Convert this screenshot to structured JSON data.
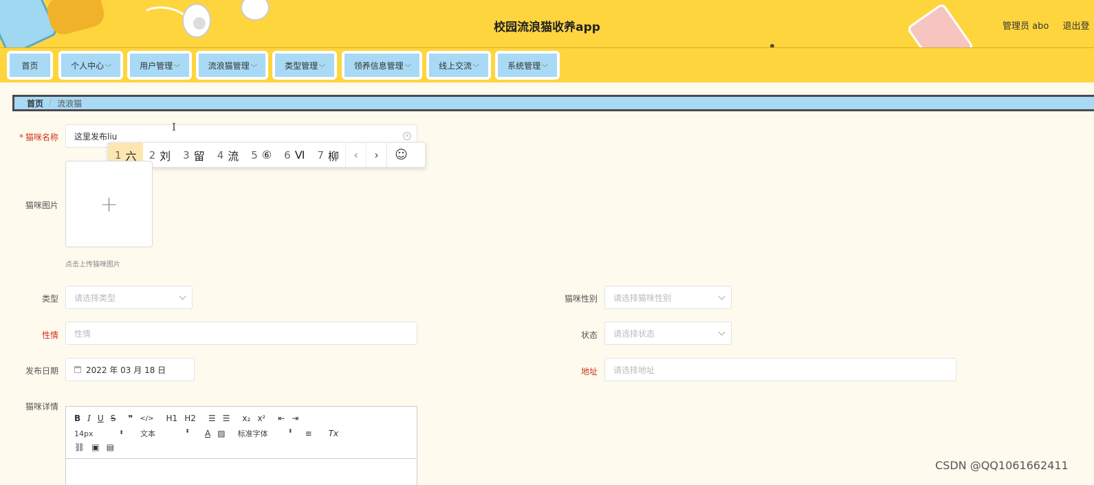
{
  "header": {
    "title": "校园流浪猫收养app",
    "user_label": "管理员 abo",
    "logout_label": "退出登"
  },
  "nav": {
    "items": [
      {
        "label": "首页",
        "dropdown": false
      },
      {
        "label": "个人中心",
        "dropdown": true
      },
      {
        "label": "用户管理",
        "dropdown": true
      },
      {
        "label": "流浪猫管理",
        "dropdown": true
      },
      {
        "label": "类型管理",
        "dropdown": true
      },
      {
        "label": "领养信息管理",
        "dropdown": true
      },
      {
        "label": "线上交流",
        "dropdown": true
      },
      {
        "label": "系统管理",
        "dropdown": true
      }
    ],
    "chevron_icon": "chevron-down-icon"
  },
  "breadcrumb": {
    "home": "首页",
    "separator": "/",
    "current": "流浪猫"
  },
  "form": {
    "cat_name": {
      "label": "猫咪名称",
      "required_mark": "*",
      "value": "这里发布liu"
    },
    "cat_image": {
      "label": "猫咪图片",
      "upload_tip": "点击上传猫咪图片",
      "icon": "plus-icon"
    },
    "type": {
      "label": "类型",
      "placeholder": "请选择类型"
    },
    "gender": {
      "label": "猫咪性别",
      "placeholder": "请选择猫咪性别"
    },
    "temperament": {
      "label": "性情",
      "placeholder": "性情"
    },
    "status": {
      "label": "状态",
      "placeholder": "请选择状态"
    },
    "publish_date": {
      "label": "发布日期",
      "value": "2022 年 03 月 18 日"
    },
    "address": {
      "label": "地址",
      "placeholder": "请选择地址"
    },
    "details": {
      "label": "猫咪详情"
    }
  },
  "ime": {
    "candidates": [
      {
        "n": "1",
        "text": "六"
      },
      {
        "n": "2",
        "text": "刘"
      },
      {
        "n": "3",
        "text": "留"
      },
      {
        "n": "4",
        "text": "流"
      },
      {
        "n": "5",
        "text": "⑥"
      },
      {
        "n": "6",
        "text": "Ⅵ"
      },
      {
        "n": "7",
        "text": "柳"
      }
    ],
    "prev": "‹",
    "next": "›",
    "emoji": "☺"
  },
  "editor": {
    "row1": [
      "B",
      "I",
      "U",
      "S",
      "❞",
      "</>",
      "H1",
      "H2",
      "ol",
      "ul",
      "x₂",
      "x²",
      "outdent",
      "indent"
    ],
    "font_size": "14px",
    "header_select": "文本",
    "font_family": "标准字体",
    "updown": "⬍"
  },
  "watermark": "CSDN @QQ1061662411",
  "colors": {
    "header_bg": "#ffd53e",
    "nav_tab_bg": "#a8daf6",
    "page_bg": "#fffaee",
    "required_red": "#d0331f"
  }
}
